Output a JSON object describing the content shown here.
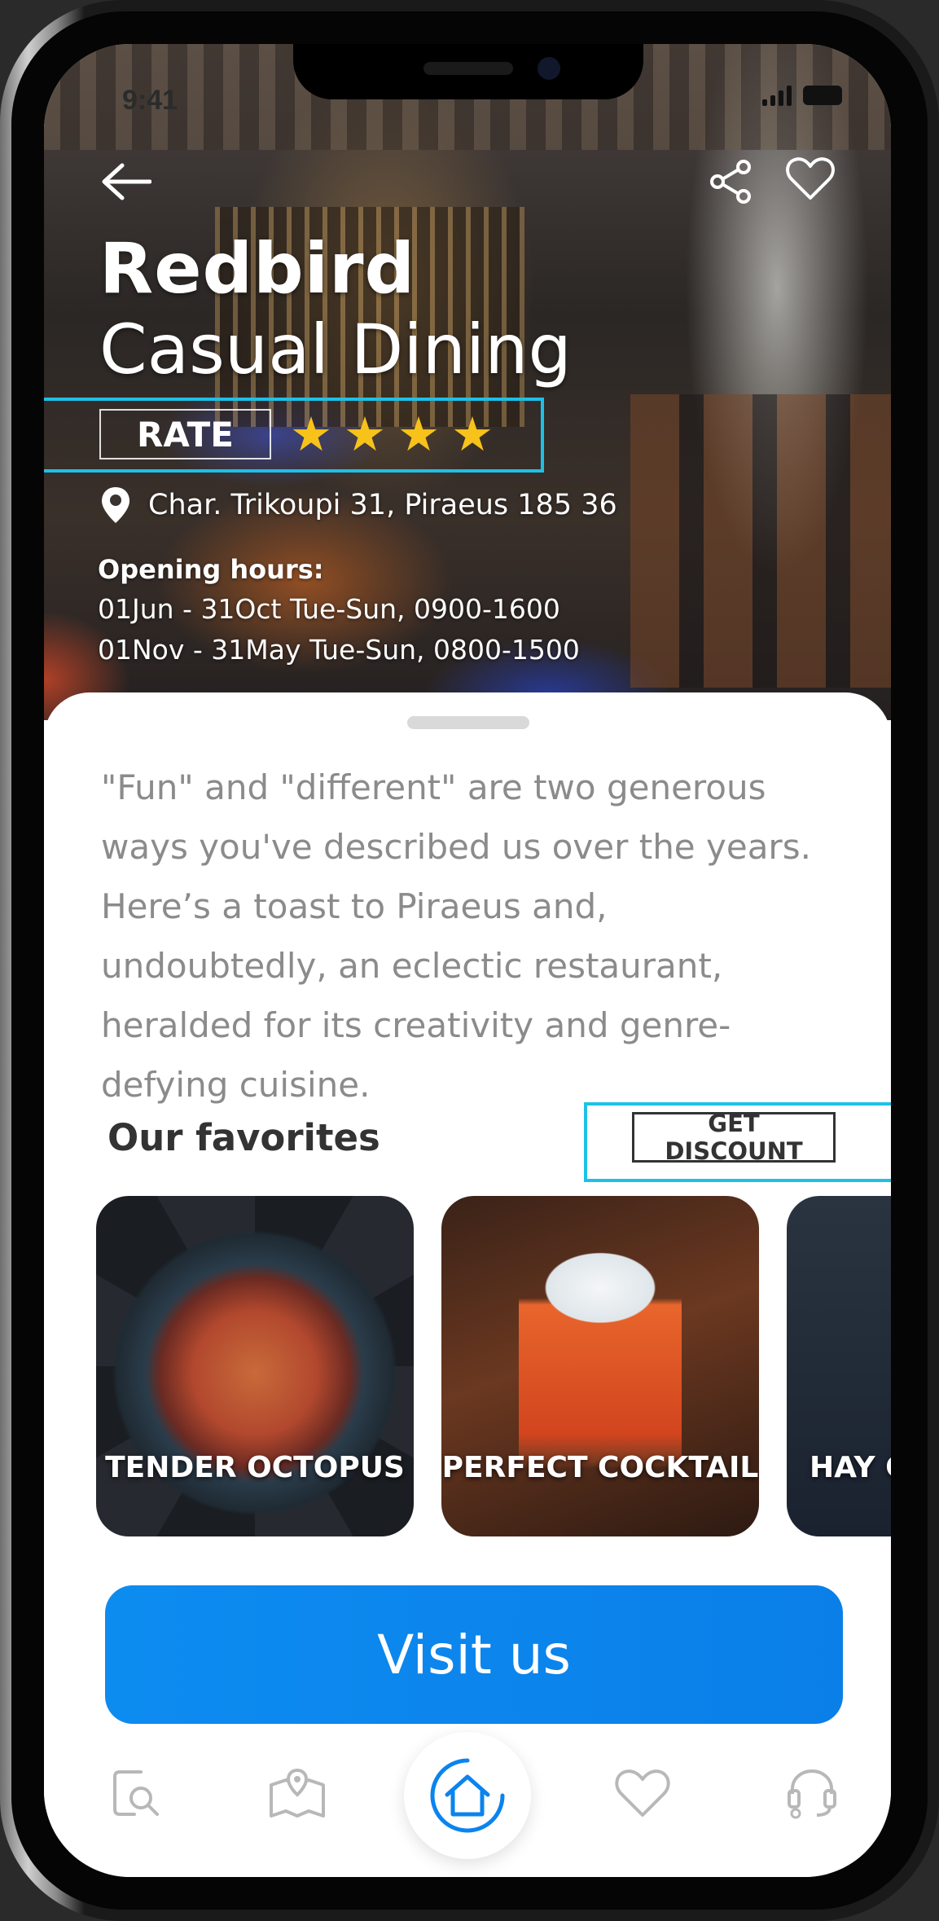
{
  "status_bar": {
    "time": "9:41"
  },
  "restaurant": {
    "name": "Redbird",
    "category": "Casual Dining",
    "rate_label": "RATE",
    "rating_stars": 4,
    "address": "Char. Trikoupi 31, Piraeus 185 36",
    "hours_label": "Opening hours:",
    "hours": [
      "01Jun - 31Oct Tue-Sun, 0900-1600",
      "01Nov - 31May Tue-Sun, 0800-1500"
    ]
  },
  "description": "\"Fun\" and \"different\" are two generous ways you've described us over the years. Here’s a toast to Piraeus and, undoubtedly, an eclectic restaurant, heralded for its creativity and genre-defying cuisine.",
  "favorites": {
    "title": "Our favorites",
    "discount_label": "GET DISCOUNT",
    "items": [
      {
        "label": "TENDER OCTOPUS"
      },
      {
        "label": "PERFECT COCKTAIL"
      },
      {
        "label": "HAY C"
      }
    ]
  },
  "cta": {
    "label": "Visit us"
  },
  "nav": {
    "items": [
      {
        "icon": "search-icon"
      },
      {
        "icon": "map-icon"
      },
      {
        "icon": "home-icon",
        "active": true
      },
      {
        "icon": "heart-icon"
      },
      {
        "icon": "support-icon"
      }
    ]
  },
  "colors": {
    "accent": "#0a84ee",
    "highlight": "#1ec0e6",
    "star": "#f7c31a",
    "body_text": "#8b8b8b"
  }
}
